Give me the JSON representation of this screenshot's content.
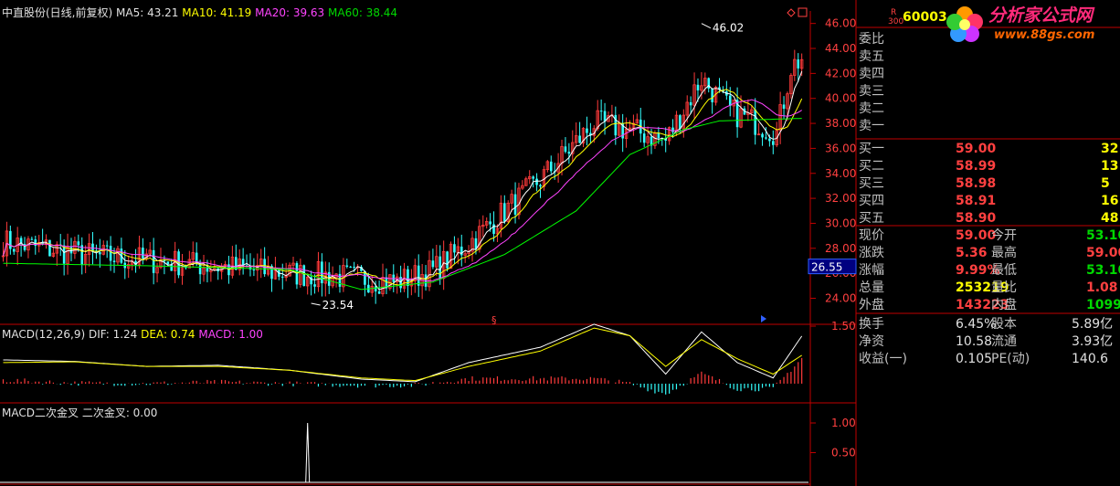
{
  "colors": {
    "up": "#ff3b3b",
    "down": "#33ffff",
    "ma5": "#ffffff",
    "ma10": "#ffff00",
    "ma20": "#ff44ff",
    "ma60": "#00ff00",
    "frame": "#c00000",
    "dif": "#ffffff",
    "dea": "#ffff00"
  },
  "header": {
    "title": "中直股份(日线,前复权)",
    "ma5": "MA5: 43.21",
    "ma10": "MA10: 41.19",
    "ma20": "MA20: 39.63",
    "ma60": "MA60: 38.44"
  },
  "macd_header": {
    "name": "MACD(12,26,9)",
    "dif": "DIF: 1.24",
    "dea": "DEA: 0.74",
    "macd": "MACD: 1.00"
  },
  "cross_header": {
    "name": "MACD二次金叉",
    "value": "二次金叉: 0.00"
  },
  "price_axis": [
    "46.00",
    "44.00",
    "42.00",
    "40.00",
    "38.00",
    "36.00",
    "34.00",
    "32.00",
    "30.00",
    "28.00",
    "26.00",
    "24.00"
  ],
  "macd_axis": [
    "1.50"
  ],
  "cross_axis": [
    "1.00",
    "0.50"
  ],
  "current_price_marker": "26.55",
  "annotations": {
    "high": "46.02",
    "low": "23.54"
  },
  "quote": {
    "code": "60003",
    "r_label": "R",
    "r_sub": "300",
    "weibi": "委比",
    "sells": [
      "卖五",
      "卖四",
      "卖三",
      "卖二",
      "卖一"
    ],
    "buys": [
      {
        "label": "买一",
        "price": "59.00",
        "vol": "3214"
      },
      {
        "label": "买二",
        "price": "58.99",
        "vol": "13"
      },
      {
        "label": "买三",
        "price": "58.98",
        "vol": "5"
      },
      {
        "label": "买四",
        "price": "58.91",
        "vol": "16"
      },
      {
        "label": "买五",
        "price": "58.90",
        "vol": "48"
      }
    ],
    "stats": [
      {
        "l1": "现价",
        "v1": "59.00",
        "l2": "今开",
        "v2": "53.10"
      },
      {
        "l1": "涨跌",
        "v1": "5.36",
        "l2": "最高",
        "v2": "59.00"
      },
      {
        "l1": "涨幅",
        "v1": "9.99%",
        "l2": "最低",
        "v2": "53.10"
      },
      {
        "l1": "总量",
        "v1": "253219",
        "l2": "量比",
        "v2": "1.08"
      },
      {
        "l1": "外盘",
        "v1": "143223",
        "l2": "内盘",
        "v2": "109996"
      }
    ],
    "stats2": [
      {
        "l1": "换手",
        "v1": "6.45%",
        "l2": "股本",
        "v2": "5.89亿"
      },
      {
        "l1": "净资",
        "v1": "10.58",
        "l2": "流通",
        "v2": "3.93亿"
      },
      {
        "l1": "收益(一)",
        "v1": "0.105",
        "l2": "PE(动)",
        "v2": "140.6"
      }
    ]
  },
  "logo": {
    "text": "分析家公式网",
    "url": "www.88gs.com"
  },
  "chart_data": {
    "type": "candlestick",
    "ylim": [
      22.5,
      47
    ],
    "ma_keys": [
      [
        0,
        28.5
      ],
      [
        25,
        27.4
      ],
      [
        50,
        26.8
      ],
      [
        75,
        26.1
      ],
      [
        100,
        25.6
      ],
      [
        110,
        25.3
      ],
      [
        120,
        26.2
      ],
      [
        130,
        28.4
      ],
      [
        150,
        33.5
      ],
      [
        165,
        38.0
      ],
      [
        175,
        37.5
      ],
      [
        185,
        36.6
      ],
      [
        195,
        41.6
      ],
      [
        203,
        39.0
      ],
      [
        210,
        38.1
      ],
      [
        216,
        37.2
      ],
      [
        220,
        42.5
      ],
      [
        223,
        43.2
      ]
    ],
    "ma60_keys": [
      [
        0,
        26.8
      ],
      [
        40,
        26.6
      ],
      [
        80,
        26.3
      ],
      [
        100,
        24.7
      ],
      [
        120,
        25.3
      ],
      [
        140,
        27.5
      ],
      [
        160,
        31.0
      ],
      [
        175,
        35.5
      ],
      [
        190,
        37.5
      ],
      [
        200,
        38.2
      ],
      [
        223,
        38.4
      ]
    ],
    "macd": [
      [
        0,
        0.62
      ],
      [
        20,
        0.58
      ],
      [
        40,
        0.45
      ],
      [
        60,
        0.48
      ],
      [
        80,
        0.35
      ],
      [
        100,
        0.12
      ],
      [
        115,
        0.05
      ],
      [
        130,
        0.55
      ],
      [
        150,
        0.95
      ],
      [
        165,
        1.55
      ],
      [
        175,
        1.25
      ],
      [
        185,
        0.25
      ],
      [
        195,
        1.35
      ],
      [
        205,
        0.55
      ],
      [
        215,
        0.15
      ],
      [
        223,
        1.24
      ]
    ],
    "dea": [
      [
        0,
        0.55
      ],
      [
        20,
        0.57
      ],
      [
        40,
        0.45
      ],
      [
        60,
        0.45
      ],
      [
        80,
        0.35
      ],
      [
        100,
        0.15
      ],
      [
        115,
        0.08
      ],
      [
        130,
        0.45
      ],
      [
        150,
        0.85
      ],
      [
        165,
        1.45
      ],
      [
        175,
        1.25
      ],
      [
        185,
        0.45
      ],
      [
        195,
        1.15
      ],
      [
        205,
        0.65
      ],
      [
        215,
        0.25
      ],
      [
        223,
        0.74
      ]
    ],
    "signal_bar_index": 85
  }
}
